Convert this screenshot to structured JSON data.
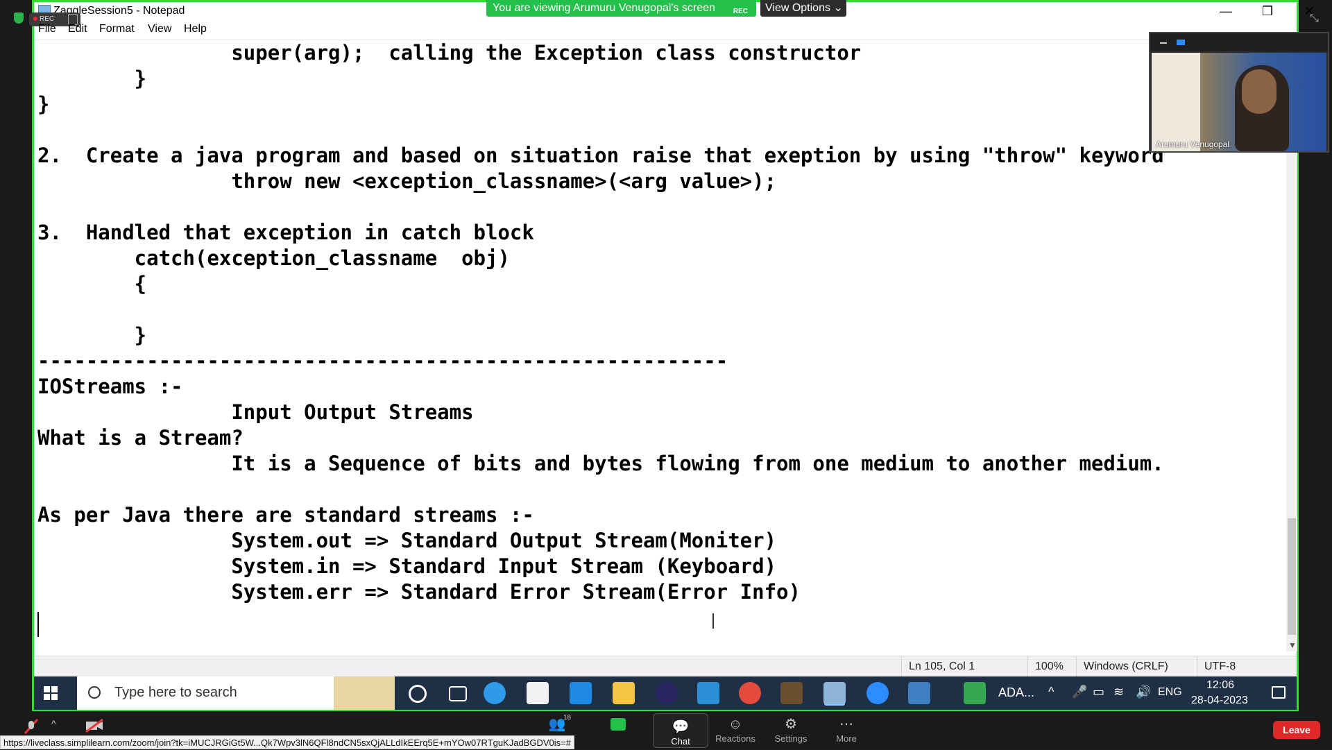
{
  "zoom": {
    "rec_label": "REC",
    "viewing_banner": "You are viewing Arumuru Venugopal's screen",
    "banner_rec": "REC",
    "view_options": "View Options",
    "participant_name": "Arumuru Venugopal",
    "participants_count": "18",
    "bottom_bar": {
      "chat": "Chat",
      "reactions": "Reactions",
      "settings": "Settings",
      "more": "More",
      "leave": "Leave"
    },
    "url_tooltip": "https://liveclass.simplilearn.com/zoom/join?tk=iMUCJRGiGt5W...Qk7Wpv3lN6QFl8ndCN5sxQjALLdIkEErq5E+mYOw07RTguKJadBGDV0is=#"
  },
  "notepad": {
    "title": "ZaggleSession5 - Notepad",
    "menu": [
      "File",
      "Edit",
      "Format",
      "View",
      "Help"
    ],
    "lines": [
      "                super(arg);  calling the Exception class constructor",
      "        }",
      "}",
      "",
      "2.  Create a java program and based on situation raise that exeption by using \"throw\" keyword",
      "                throw new <exception_classname>(<arg value>);",
      "",
      "3.  Handled that exception in catch block",
      "        catch(exception_classname  obj)",
      "        {",
      "",
      "        }",
      "---------------------------------------------------------",
      "IOStreams :-",
      "                Input Output Streams",
      "What is a Stream?",
      "                It is a Sequence of bits and bytes flowing from one medium to another medium.",
      "",
      "As per Java there are standard streams :-",
      "                System.out => Standard Output Stream(Moniter)",
      "                System.in => Standard Input Stream (Keyboard)",
      "                System.err => Standard Error Stream(Error Info)"
    ],
    "status": {
      "position": "Ln 105, Col 1",
      "zoom": "100%",
      "line_endings": "Windows (CRLF)",
      "encoding": "UTF-8"
    }
  },
  "taskbar": {
    "search_placeholder": "Type here to search",
    "app_label": "ADA...",
    "language": "ENG",
    "time": "12:06",
    "date": "28-04-2023"
  }
}
